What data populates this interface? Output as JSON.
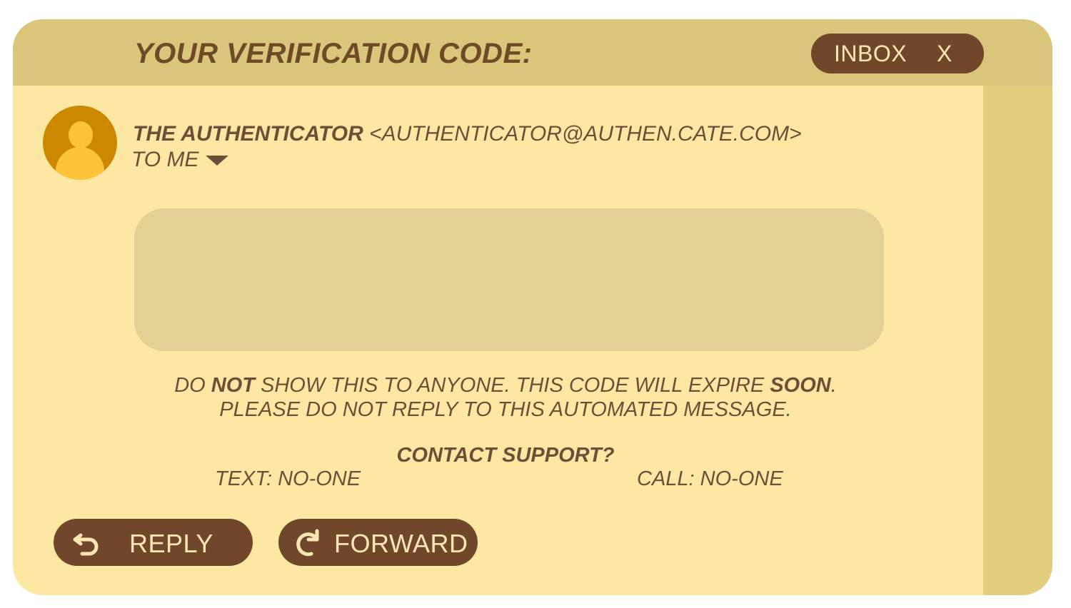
{
  "header": {
    "title": "YOUR VERIFICATION CODE:",
    "inbox_label": "INBOX",
    "close_label": "X"
  },
  "sender": {
    "name": "THE AUTHENTICATOR",
    "email": "<AUTHENTICATOR@AUTHEN.CATE.COM>",
    "recipient": "TO ME"
  },
  "notice": {
    "part1": "DO ",
    "bold1": "NOT",
    "part2": " SHOW THIS TO ANYONE. THIS CODE WILL EXPIRE ",
    "bold2": "SOON",
    "part3": ".",
    "line2": "PLEASE DO NOT REPLY TO THIS AUTOMATED MESSAGE."
  },
  "support": {
    "title": "CONTACT SUPPORT?",
    "text": "TEXT: NO-ONE",
    "call": "CALL: NO-ONE"
  },
  "actions": {
    "reply_label": "REPLY",
    "forward_label": "FORWARD"
  },
  "icons": {
    "avatar": "user-avatar-icon",
    "dropdown": "chevron-down-icon",
    "reply": "reply-arrow-icon",
    "forward": "forward-arrow-icon"
  },
  "colors": {
    "background": "#fde8a3",
    "header": "#d9c67a",
    "side_panel": "#e3cd7e",
    "code_box": "#e3d195",
    "button": "#70472a",
    "button_text": "#fce7b3",
    "text": "#6e4e38",
    "avatar_bg": "#cc8800",
    "avatar_fg": "#ffc23b"
  }
}
